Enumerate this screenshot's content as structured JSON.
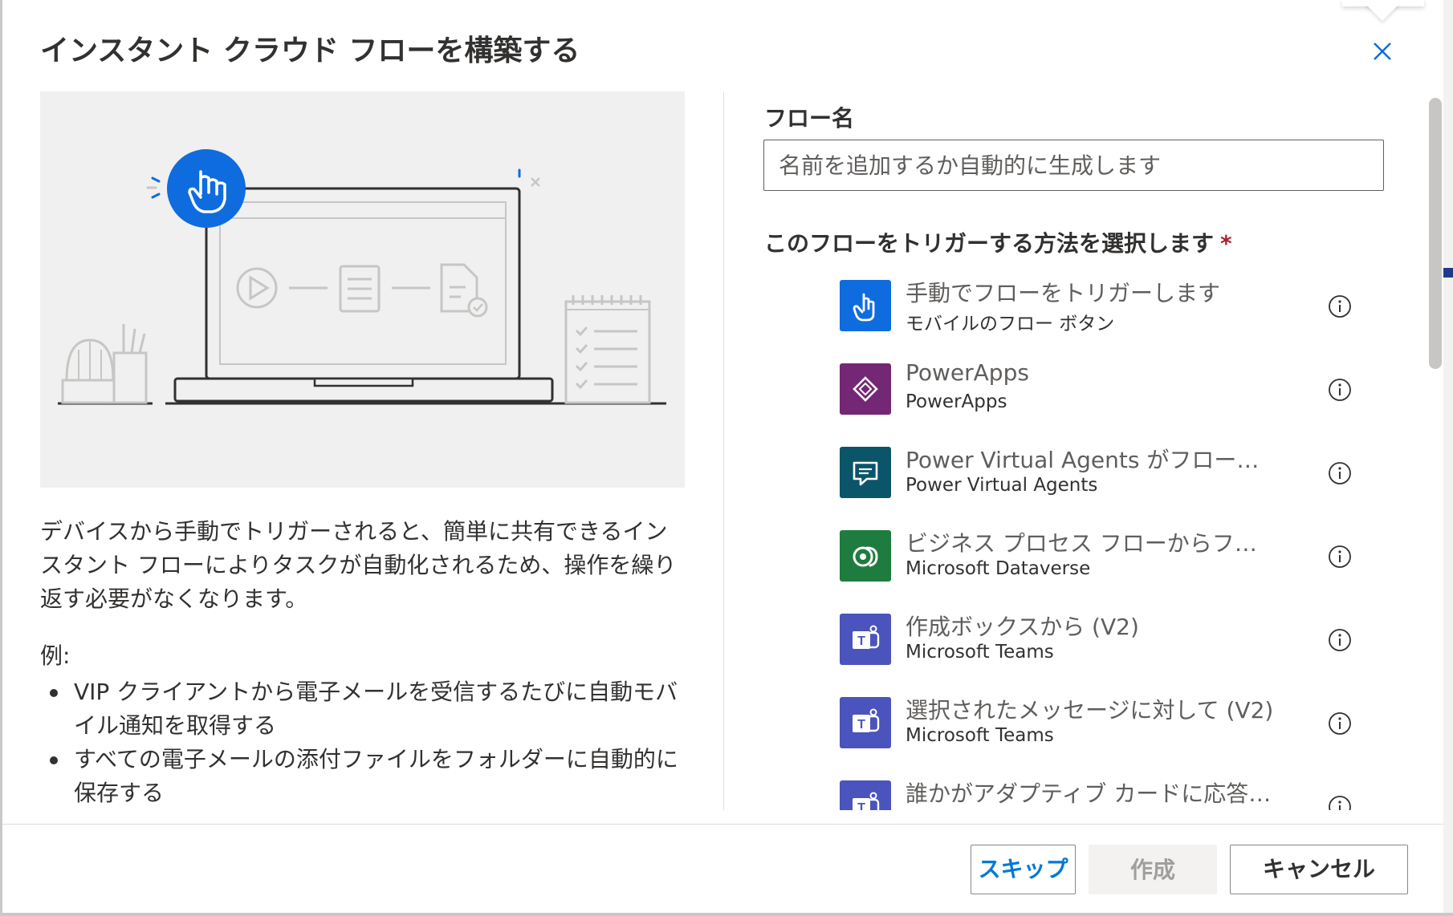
{
  "dialog": {
    "title": "インスタント クラウド フローを構築する"
  },
  "description": {
    "text": "デバイスから手動でトリガーされると、簡単に共有できるインスタント フローによりタスクが自動化されるため、操作を繰り返す必要がなくなります。",
    "examples_label": "例:",
    "examples": [
      "VIP クライアントから電子メールを受信するたびに自動モバイル通知を取得する",
      "すべての電子メールの添付ファイルをフォルダーに自動的に保存する"
    ]
  },
  "form": {
    "flow_name_label": "フロー名",
    "flow_name_placeholder": "名前を追加するか自動的に生成します",
    "flow_name_value": "",
    "trigger_label": "このフローをトリガーする方法を選択します",
    "required_mark": "*"
  },
  "triggers": [
    {
      "title": "手動でフローをトリガーします",
      "connector": "モバイルのフロー ボタン",
      "icon": "touch-hand-icon",
      "color": "#0f6cde"
    },
    {
      "title": "PowerApps",
      "connector": "PowerApps",
      "icon": "powerapps-icon",
      "color": "#742774"
    },
    {
      "title": "Power Virtual Agents がフローを呼...",
      "connector": "Power Virtual Agents",
      "icon": "chat-bot-icon",
      "color": "#0b556a"
    },
    {
      "title": "ビジネス プロセス フローからフロ...",
      "connector": "Microsoft Dataverse",
      "icon": "dataverse-icon",
      "color": "#1e7c3e"
    },
    {
      "title": "作成ボックスから (V2)",
      "connector": "Microsoft Teams",
      "icon": "teams-icon",
      "color": "#4b53bc"
    },
    {
      "title": "選択されたメッセージに対して (V2)",
      "connector": "Microsoft Teams",
      "icon": "teams-icon",
      "color": "#4b53bc"
    },
    {
      "title": "誰かがアダプティブ カードに応答し...",
      "connector": "",
      "icon": "teams-icon",
      "color": "#4b53bc"
    }
  ],
  "buttons": {
    "skip": "スキップ",
    "create": "作成",
    "cancel": "キャンセル"
  },
  "colors": {
    "accent": "#0078d4",
    "illustration_blue": "#0f6cde"
  }
}
